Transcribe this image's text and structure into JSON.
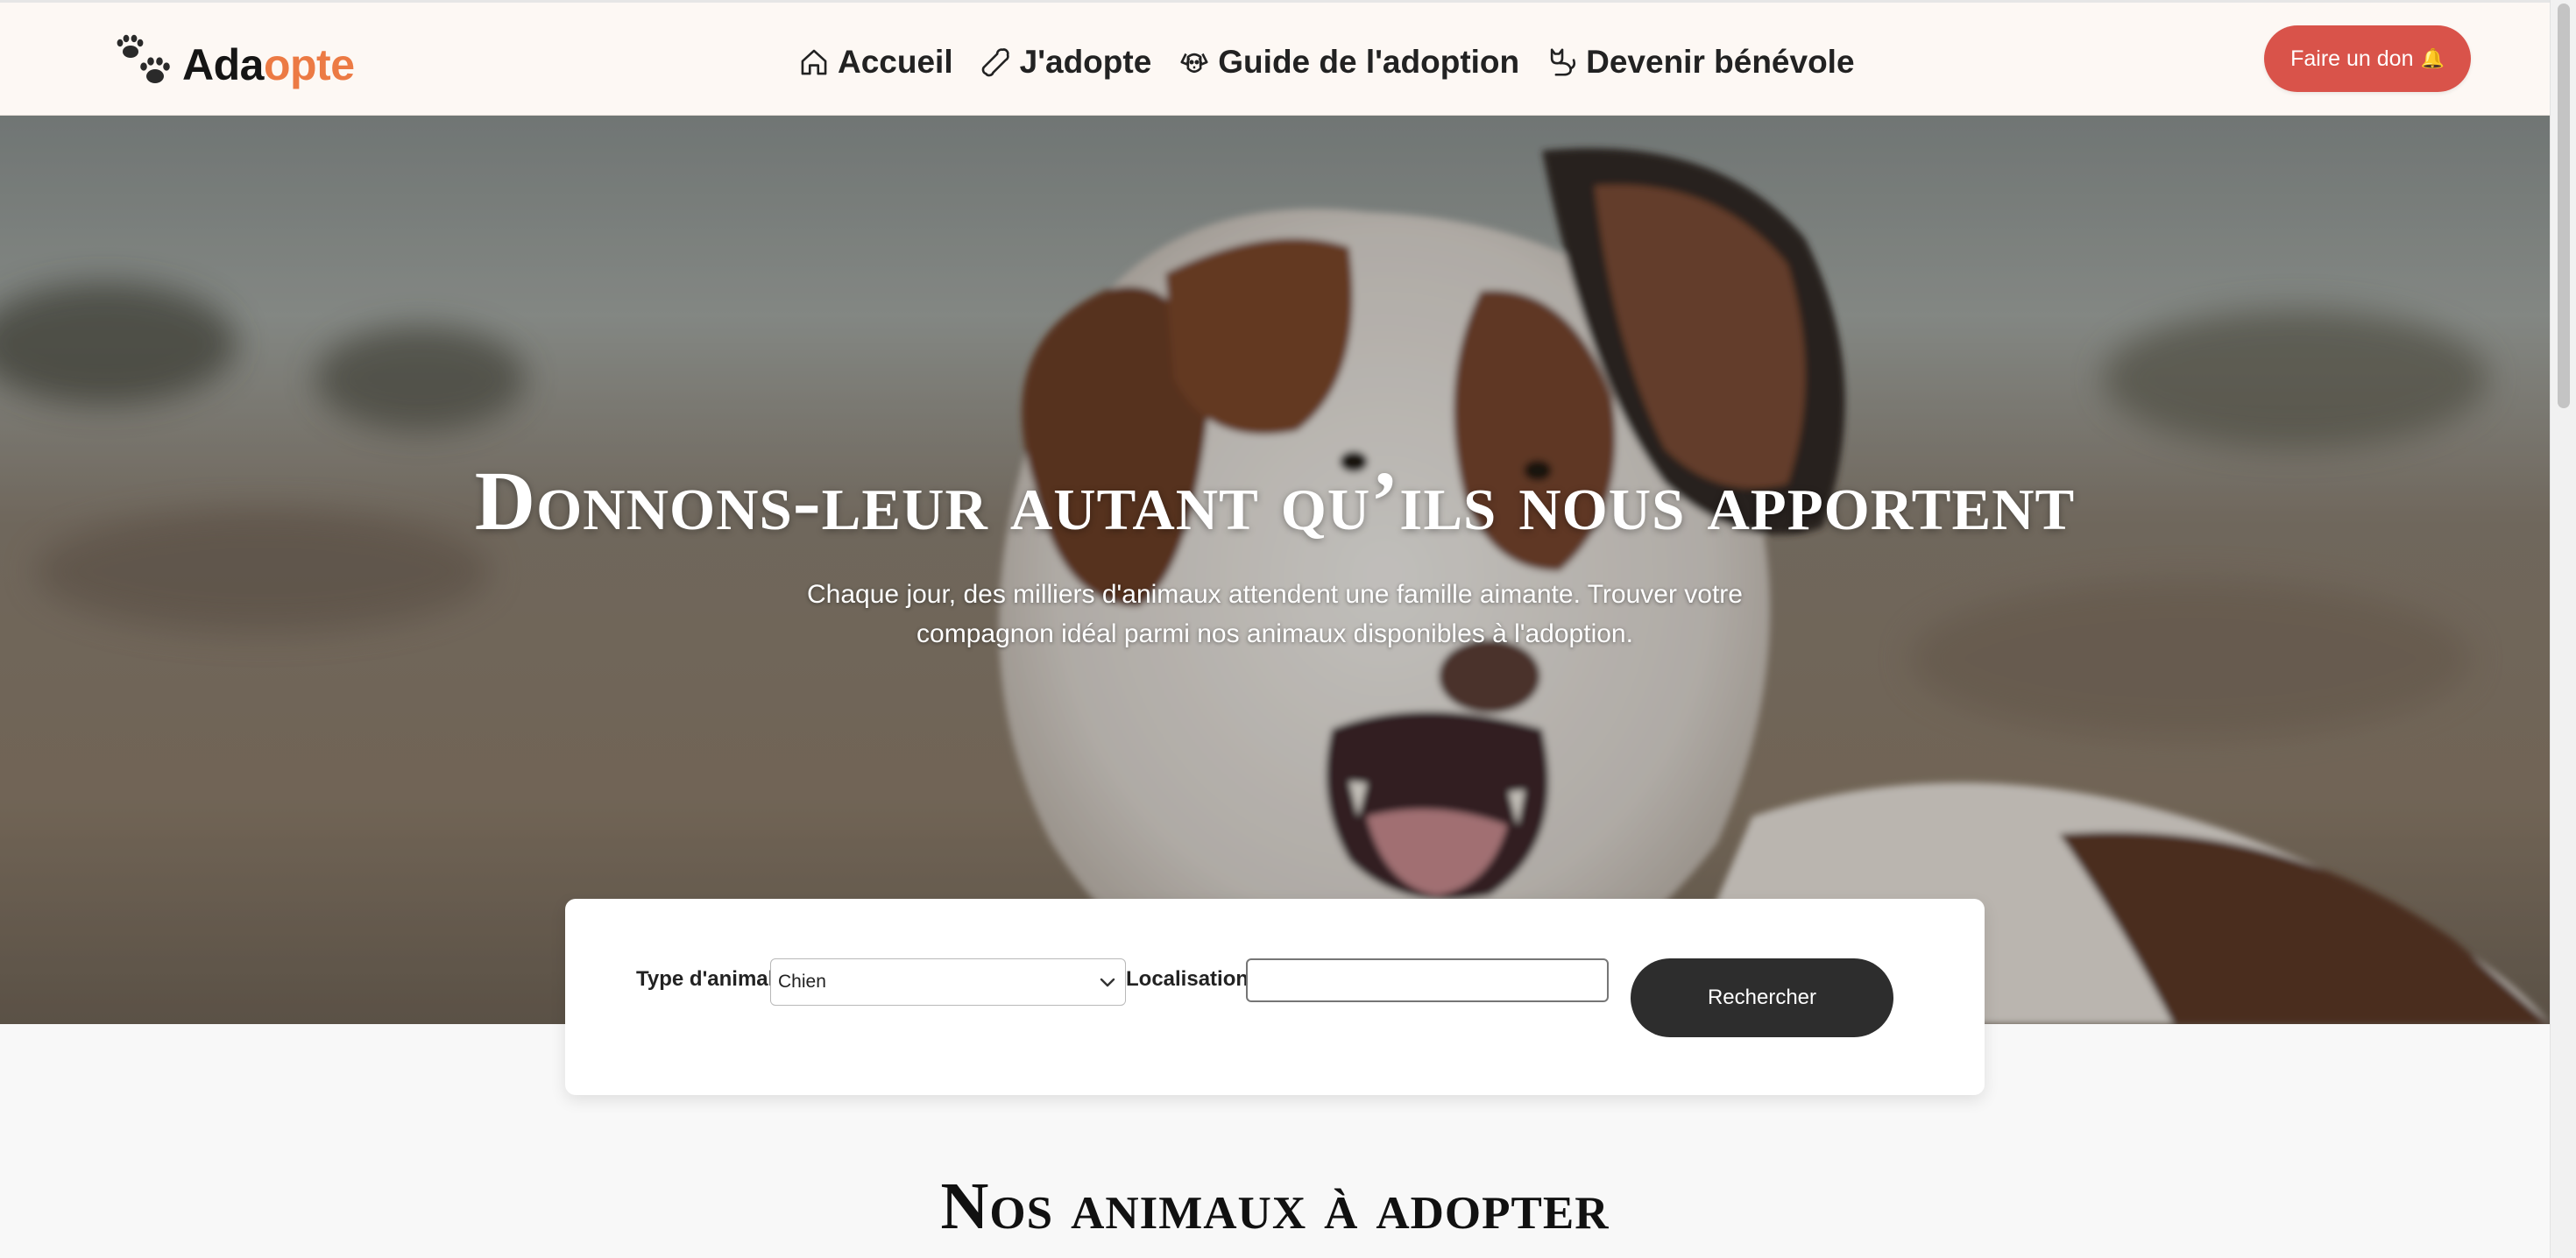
{
  "header": {
    "logo": {
      "part1": "Ada",
      "part2": "opte"
    },
    "nav": [
      {
        "label": "Accueil",
        "icon": "home-icon"
      },
      {
        "label": "J'adopte",
        "icon": "bone-icon"
      },
      {
        "label": "Guide de l'adoption",
        "icon": "dog-face-icon"
      },
      {
        "label": "Devenir bénévole",
        "icon": "cat-icon"
      }
    ],
    "donate": {
      "label": "Faire un don",
      "icon": "bell-icon"
    }
  },
  "hero": {
    "title": "Donnons-leur autant qu’ils nous apportent",
    "subtitle": "Chaque jour, des milliers d'animaux attendent une famille aimante. Trouver votre compagnon idéal parmi nos animaux disponibles à l'adoption."
  },
  "search": {
    "type_label": "Type d'animal",
    "type_value": "Chien",
    "location_label": "Localisation",
    "location_value": "",
    "button_label": "Rechercher"
  },
  "section": {
    "title": "Nos animaux à adopter"
  },
  "colors": {
    "accent_orange": "#ec7a44",
    "donate_red": "#d9534a",
    "header_bg": "#fdf8f4",
    "button_dark": "#2d2d2d"
  }
}
